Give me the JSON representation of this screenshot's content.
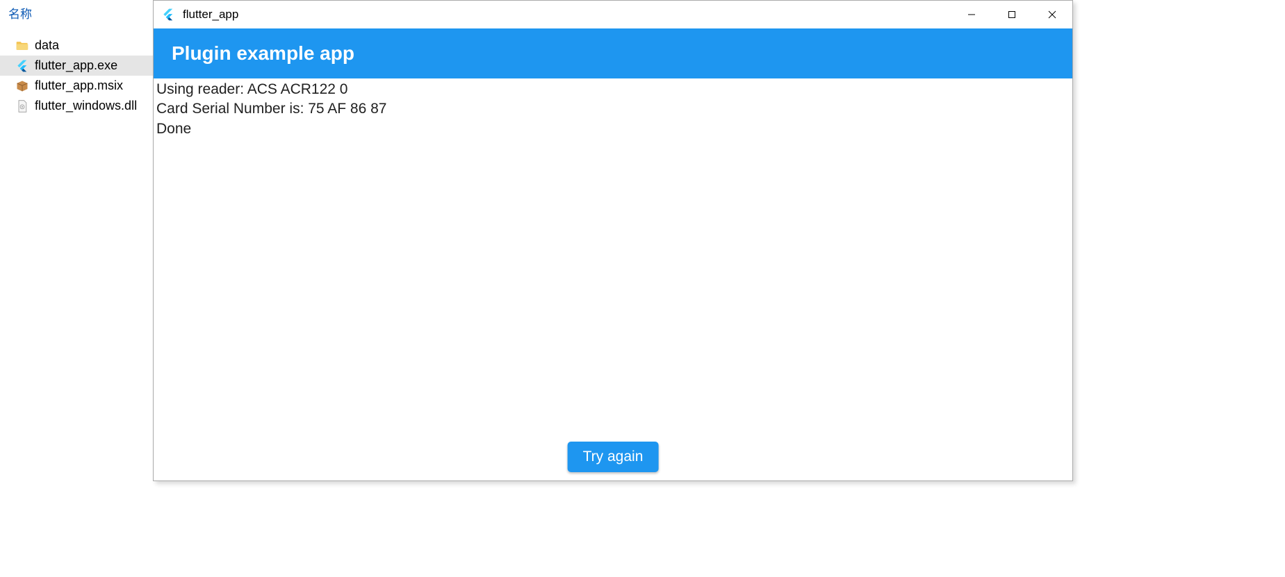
{
  "explorer": {
    "header": "名称",
    "items": [
      {
        "name": "data",
        "iconType": "folder"
      },
      {
        "name": "flutter_app.exe",
        "iconType": "flutter",
        "selected": true
      },
      {
        "name": "flutter_app.msix",
        "iconType": "package"
      },
      {
        "name": "flutter_windows.dll",
        "iconType": "dll"
      }
    ]
  },
  "window": {
    "title": "flutter_app",
    "appHeader": "Plugin example app",
    "body": {
      "lines": [
        "Using reader: ACS ACR122 0",
        "Card Serial Number is: 75 AF 86 87",
        "Done"
      ]
    },
    "button": "Try again"
  }
}
